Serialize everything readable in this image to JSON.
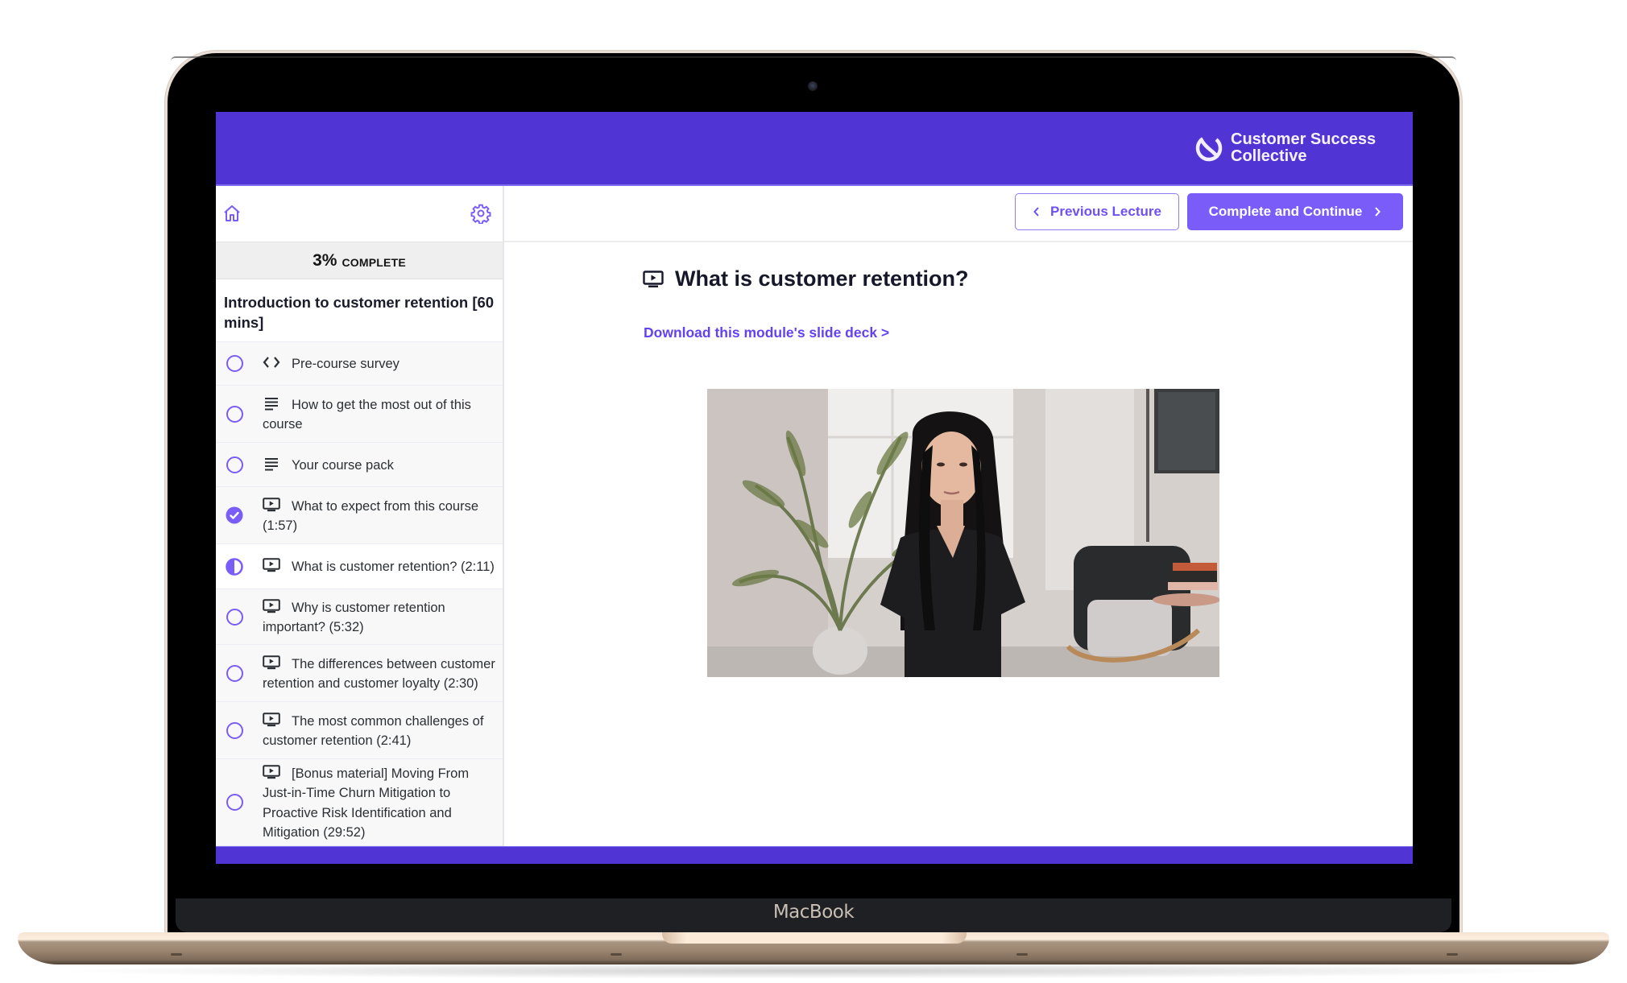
{
  "device": {
    "label": "MacBook"
  },
  "brand": {
    "name": "Customer Success Collective",
    "color": "#5035d4",
    "accent": "#7a5cf8"
  },
  "sidebar": {
    "home_icon": "home-icon",
    "settings_icon": "gear-icon",
    "progress": {
      "percent_label": "3%",
      "percent": 3,
      "suffix": "COMPLETE"
    },
    "module_title": "Introduction to customer retention [60 mins]",
    "items": [
      {
        "label": "Pre-course survey",
        "type_icon": "code-icon",
        "status": "not-started"
      },
      {
        "label": "How to get the most out of this course",
        "type_icon": "text-lines-icon",
        "status": "not-started"
      },
      {
        "label": "Your course pack",
        "type_icon": "text-lines-icon",
        "status": "not-started"
      },
      {
        "label": "What to expect from this course (1:57)",
        "type_icon": "video-icon",
        "status": "completed"
      },
      {
        "label": "What is customer retention? (2:11)",
        "type_icon": "video-icon",
        "status": "in-progress",
        "active": true
      },
      {
        "label": "Why is customer retention important? (5:32)",
        "type_icon": "video-icon",
        "status": "not-started"
      },
      {
        "label": "The differences between customer retention and customer loyalty (2:30)",
        "type_icon": "video-icon",
        "status": "not-started"
      },
      {
        "label": "The most common challenges of customer retention (2:41)",
        "type_icon": "video-icon",
        "status": "not-started"
      },
      {
        "label": "[Bonus material] Moving From Just-in-Time Churn Mitigation to Proactive Risk Identification and Mitigation (29:52)",
        "type_icon": "video-icon",
        "status": "not-started"
      }
    ]
  },
  "toolbar": {
    "previous_label": "Previous Lecture",
    "complete_label": "Complete and Continue"
  },
  "lecture": {
    "title": "What is customer retention?",
    "title_icon": "video-icon",
    "download_link": "Download this module's slide deck >",
    "video": {
      "description": "Presenter video: woman in black top seated in a living room with plant and lounge chair"
    }
  }
}
